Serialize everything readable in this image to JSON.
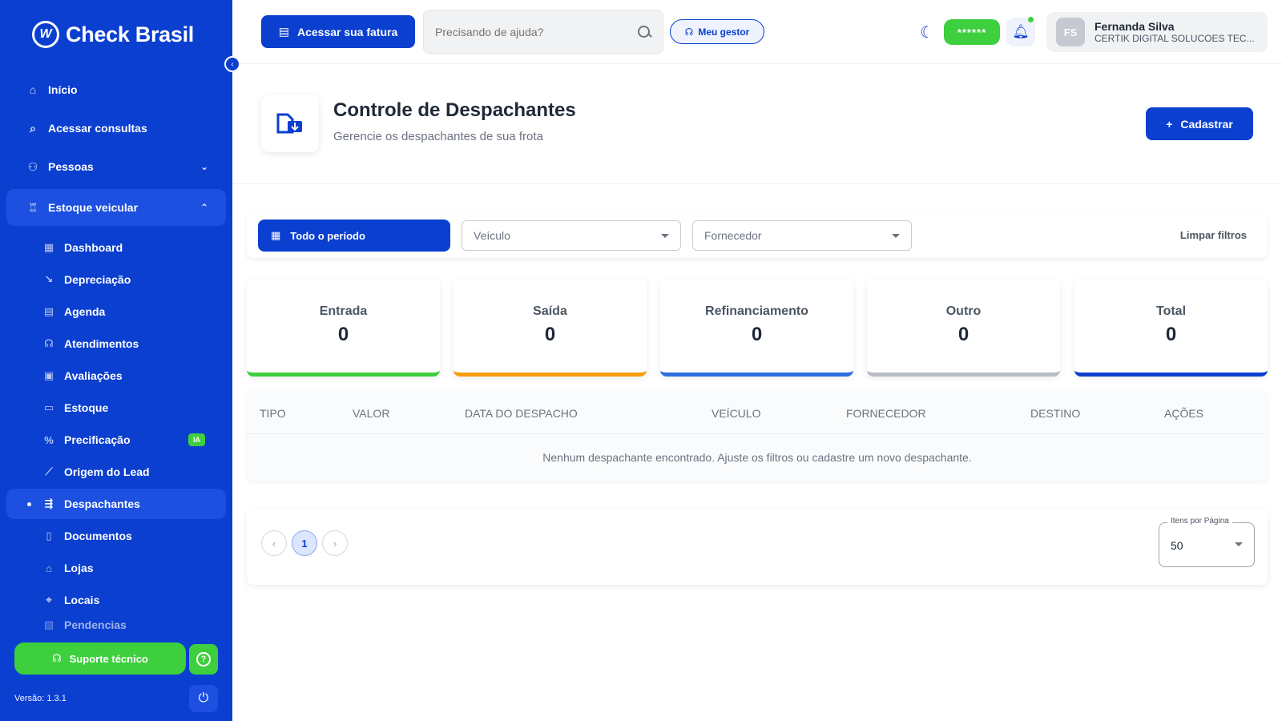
{
  "sidebar": {
    "brand": "Check Brasil",
    "brand_logo_letter": "W",
    "nav": [
      {
        "label": "Início",
        "icon": "home-icon"
      },
      {
        "label": "Acessar consultas",
        "icon": "search-icon"
      },
      {
        "label": "Pessoas",
        "icon": "people-icon"
      },
      {
        "label": "Estoque veicular",
        "icon": "vehicle-stock-icon"
      }
    ],
    "sub": [
      {
        "label": "Dashboard"
      },
      {
        "label": "Depreciação"
      },
      {
        "label": "Agenda"
      },
      {
        "label": "Atendimentos"
      },
      {
        "label": "Avaliações"
      },
      {
        "label": "Estoque"
      },
      {
        "label": "Precificação",
        "badge": "IA"
      },
      {
        "label": "Origem do Lead"
      },
      {
        "label": "Despachantes"
      },
      {
        "label": "Documentos"
      },
      {
        "label": "Lojas"
      },
      {
        "label": "Locais"
      },
      {
        "label": "Pendencias"
      }
    ],
    "support_label": "Suporte técnico",
    "version": "Versão: 1.3.1"
  },
  "topbar": {
    "fatura_label": "Acessar sua fatura",
    "search_placeholder": "Precisando de ajuda?",
    "gestor_label": "Meu gestor",
    "password_mask": "******",
    "user": {
      "initials": "FS",
      "name": "Fernanda Silva",
      "company": "CERTIK DIGITAL SOLUCOES TEC..."
    }
  },
  "page": {
    "title": "Controle de Despachantes",
    "subtitle": "Gerencie os despachantes de sua frota",
    "cadastrar_label": "Cadastrar"
  },
  "filters": {
    "periodo_label": "Todo o período",
    "veiculo_placeholder": "Veículo",
    "fornecedor_placeholder": "Fornecedor",
    "limpar_label": "Limpar filtros"
  },
  "stats": [
    {
      "label": "Entrada",
      "value": "0",
      "color": "#3ecf3e"
    },
    {
      "label": "Saída",
      "value": "0",
      "color": "#f59e0b"
    },
    {
      "label": "Refinanciamento",
      "value": "0",
      "color": "#2f6fe0"
    },
    {
      "label": "Outro",
      "value": "0",
      "color": "#b8bcc4"
    },
    {
      "label": "Total",
      "value": "0",
      "color": "#0b3fd0"
    }
  ],
  "table": {
    "columns": [
      "TIPO",
      "VALOR",
      "DATA DO DESPACHO",
      "VEÍCULO",
      "FORNECEDOR",
      "DESTINO",
      "AÇÕES"
    ],
    "empty_message": "Nenhum despachante encontrado. Ajuste os filtros ou cadastre um novo despachante."
  },
  "pagination": {
    "prev": "‹",
    "current_page": "1",
    "next": "›",
    "per_page_label": "Itens por Página",
    "per_page_value": "50"
  }
}
